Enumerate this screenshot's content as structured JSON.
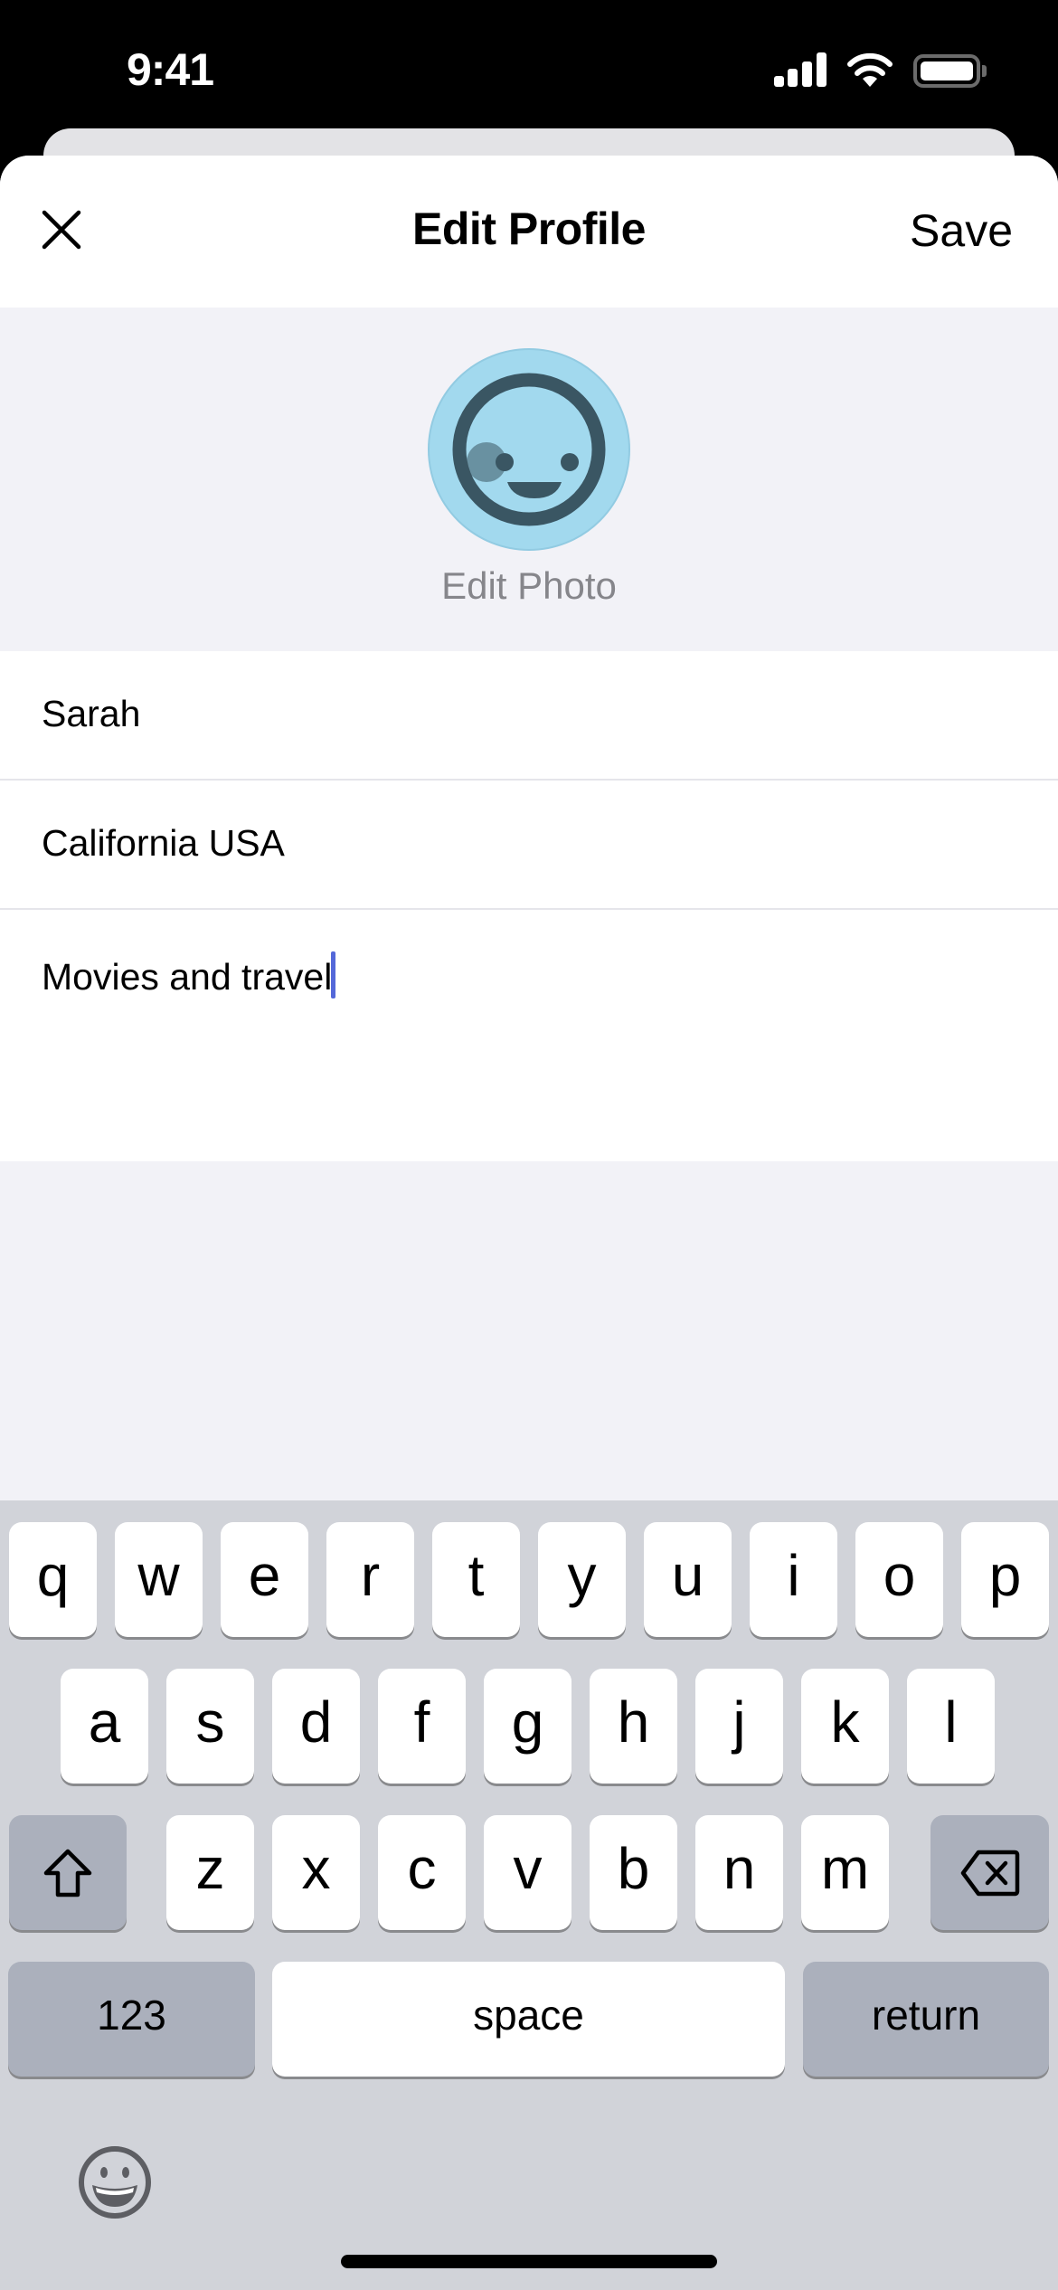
{
  "status_bar": {
    "time": "9:41",
    "icons": [
      "signal-icon",
      "wifi-icon",
      "battery-icon"
    ]
  },
  "nav": {
    "title": "Edit Profile",
    "close_icon": "close-icon",
    "save_label": "Save"
  },
  "profile_photo": {
    "icon": "smiley-avatar-icon",
    "edit_label": "Edit Photo",
    "colors": {
      "background": "#a2d9ee",
      "face": "#3a5663"
    }
  },
  "fields": [
    {
      "name": "name",
      "value": "Sarah"
    },
    {
      "name": "location",
      "value": "California USA"
    },
    {
      "name": "bio",
      "value": "Movies and travel",
      "focused": true
    }
  ],
  "keyboard": {
    "row1": [
      "q",
      "w",
      "e",
      "r",
      "t",
      "y",
      "u",
      "i",
      "o",
      "p"
    ],
    "row2": [
      "a",
      "s",
      "d",
      "f",
      "g",
      "h",
      "j",
      "k",
      "l"
    ],
    "row3": [
      "z",
      "x",
      "c",
      "v",
      "b",
      "n",
      "m"
    ],
    "shift_icon": "shift-icon",
    "delete_icon": "delete-icon",
    "numbers_label": "123",
    "space_label": "space",
    "return_label": "return",
    "emoji_icon": "emoji-icon"
  },
  "colors": {
    "caret": "#5468d9"
  }
}
